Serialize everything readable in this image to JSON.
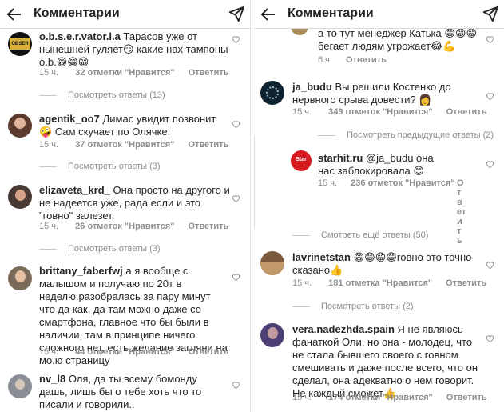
{
  "header": {
    "title": "Комментарии"
  },
  "left": {
    "comments": [
      {
        "user": "o.b.s.e.r.vator.i.a",
        "text": "Тарасов уже от нынешней гуляет😏 какие нах тампоны o.b.😁😁😁",
        "time": "15 ч.",
        "likes": "32 отметки \"Нравится\"",
        "reply": "Ответить",
        "view_replies": "Посмотреть ответы (13)"
      },
      {
        "user": "agentik_oo7",
        "text": "Димас увидит позвонит🤪 Сам скучает по Олячке.",
        "time": "15 ч.",
        "likes": "37 отметок \"Нравится\"",
        "reply": "Ответить",
        "view_replies": "Посмотреть ответы (3)"
      },
      {
        "user": "elizaveta_krd_",
        "text": "Она просто на другого и не надеется уже, рада если и это \"говно\" залезет.",
        "time": "15 ч.",
        "likes": "26 отметок \"Нравится\"",
        "reply": "Ответить",
        "view_replies": "Посмотреть ответы (3)"
      },
      {
        "user": "brittany_faberfwj",
        "text": "а я вообще с малышом и получаю по 20т в неделю.разобралась за пару минут что да как, да там можно даже со смартфона, главное что бы были в наличии, там в принципе ничего сложного нет, есть желание загляни на мо.ю страницу",
        "time": "15 ч.",
        "likes": "44 отметки \"Нравится\"",
        "reply": "Ответить"
      },
      {
        "user": "nv_l8",
        "text": "Оля, да ты всему бомонду дашь, лишь бы о тебе хоть что то писали и говорили..",
        "time": "",
        "likes": "",
        "reply": ""
      }
    ]
  },
  "right": {
    "comments": [
      {
        "user": "",
        "text": "а то тут менеджер Катька 😁😁😁 бегает людям угрожает😂💪",
        "time": "6 ч.",
        "likes": "",
        "reply": "Ответить"
      },
      {
        "user": "ja_budu",
        "text": "Вы решили Костенко до нервного срыва довести? 👩",
        "time": "15 ч.",
        "likes": "349 отметок \"Нравится\"",
        "reply": "Ответить",
        "view_replies": "Посмотреть предыдущие ответы (2)"
      },
      {
        "user": "starhit.ru",
        "text": "@ja_budu она нас заблокировала 😊",
        "time": "15 ч.",
        "likes": "236 отметок \"Нравится\"",
        "reply": "Ответить",
        "view_replies": "Смотреть ещё ответы (50)"
      },
      {
        "user": "lavrinetstan",
        "text": "😁😁😁😁говно это точно сказано👍",
        "time": "15 ч.",
        "likes": "181 отметка \"Нравится\"",
        "reply": "Ответить",
        "view_replies": "Посмотреть ответы (2)"
      },
      {
        "user": "vera.nadezhda.spain",
        "text": "Я не являюсь фанаткой Оли, но она - молодец, что не стала бывшего своего с говном смешивать и даже после всего, что он сделал, она адекватно о нем говорит. Не каждый сможет👍",
        "time": "15 ч.",
        "likes": "174 отметки \"Нравится\"",
        "reply": "Ответить"
      }
    ]
  },
  "icons": {
    "back": "arrow-left-icon",
    "send": "paper-plane-icon",
    "like": "heart-icon"
  },
  "colors": {
    "text": "#262626",
    "muted": "#8e8e8e",
    "border": "#dbdbdb",
    "mention": "#00376b"
  }
}
